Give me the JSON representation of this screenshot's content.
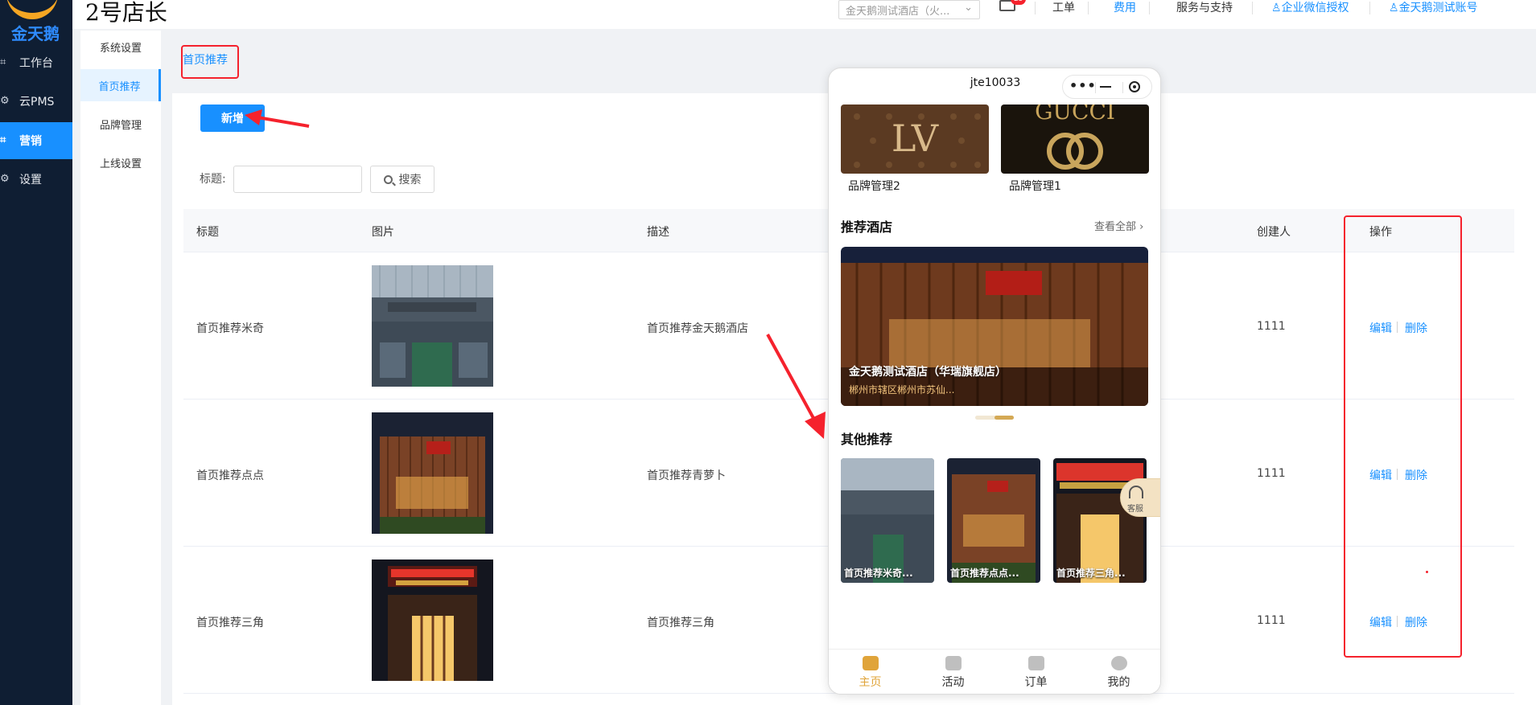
{
  "brand": {
    "logo_text": "金天鹅"
  },
  "sidebar": {
    "items": [
      {
        "label": "工作台",
        "icon": "workbench-icon"
      },
      {
        "label": "云PMS",
        "icon": "gear-icon"
      },
      {
        "label": "营销",
        "icon": "marketing-icon",
        "active": true
      },
      {
        "label": "设置",
        "icon": "gear-icon"
      }
    ]
  },
  "submenu": {
    "items": [
      {
        "label": "系统设置"
      },
      {
        "label": "首页推荐",
        "active": true
      },
      {
        "label": "品牌管理"
      },
      {
        "label": "上线设置"
      }
    ]
  },
  "header": {
    "store_title": "2号店长",
    "hotel_select": "金天鹅测试酒店（火...",
    "mail_badge": "25",
    "links": [
      "工单",
      "费用",
      "服务与支持",
      "企业微信授权",
      "金天鹅测试账号"
    ]
  },
  "page": {
    "breadcrumb": "首页推荐",
    "add_button": "新增",
    "filter_label": "标题:",
    "filter_placeholder": "",
    "search_button": "搜索"
  },
  "table": {
    "columns": [
      "标题",
      "图片",
      "描述",
      "创建人",
      "操作"
    ],
    "rows": [
      {
        "title": "首页推荐米奇",
        "desc": "首页推荐金天鹅酒店",
        "creator": "1111",
        "edit": "编辑",
        "delete": "删除"
      },
      {
        "title": "首页推荐点点",
        "desc": "首页推荐青萝卜",
        "creator": "1111",
        "edit": "编辑",
        "delete": "删除"
      },
      {
        "title": "首页推荐三角",
        "desc": "首页推荐三角",
        "creator": "1111",
        "edit": "编辑",
        "delete": "删除"
      }
    ]
  },
  "phone": {
    "title": "jte10033",
    "brands": [
      {
        "name": "品牌管理2",
        "image_text": "LV"
      },
      {
        "name": "品牌管理1",
        "image_text": "GUCCI"
      }
    ],
    "recommended_hotels_title": "推荐酒店",
    "see_all": "查看全部",
    "hero_hotel_name": "金天鹅测试酒店（华瑞旗舰店）",
    "hero_hotel_addr": "郴州市辖区郴州市苏仙...",
    "other_title": "其他推荐",
    "others": [
      {
        "label": "首页推荐米奇..."
      },
      {
        "label": "首页推荐点点..."
      },
      {
        "label": "首页推荐三角..."
      }
    ],
    "kefu_label": "客服",
    "tabs": [
      {
        "label": "主页",
        "active": true
      },
      {
        "label": "活动"
      },
      {
        "label": "订单"
      },
      {
        "label": "我的"
      }
    ]
  },
  "colors": {
    "primary": "#1890ff",
    "sidebar_bg": "#0f1e33",
    "annotation_red": "#f5222d",
    "tab_active": "#e0a43a"
  }
}
